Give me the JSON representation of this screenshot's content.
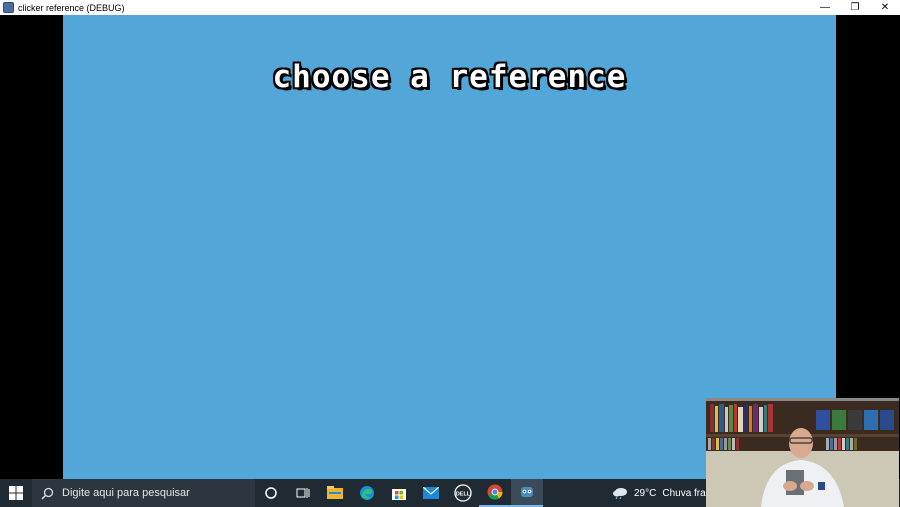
{
  "window": {
    "title": "clicker reference (DEBUG)",
    "minimize_glyph": "—",
    "restore_glyph": "❐",
    "close_glyph": "✕"
  },
  "game": {
    "title": "choose a reference",
    "background_color": "#53a7d8"
  },
  "taskbar": {
    "search_placeholder": "Digite aqui para pesquisar",
    "icons": [
      "windows-start-icon",
      "search-icon",
      "cortana-icon",
      "task-view-icon",
      "file-explorer-icon",
      "edge-icon",
      "microsoft-store-icon",
      "mail-icon",
      "dell-icon",
      "chrome-icon",
      "godot-icon"
    ],
    "dell_label": "DELL",
    "weather": {
      "temperature": "29°C",
      "condition": "Chuva fraca"
    }
  }
}
